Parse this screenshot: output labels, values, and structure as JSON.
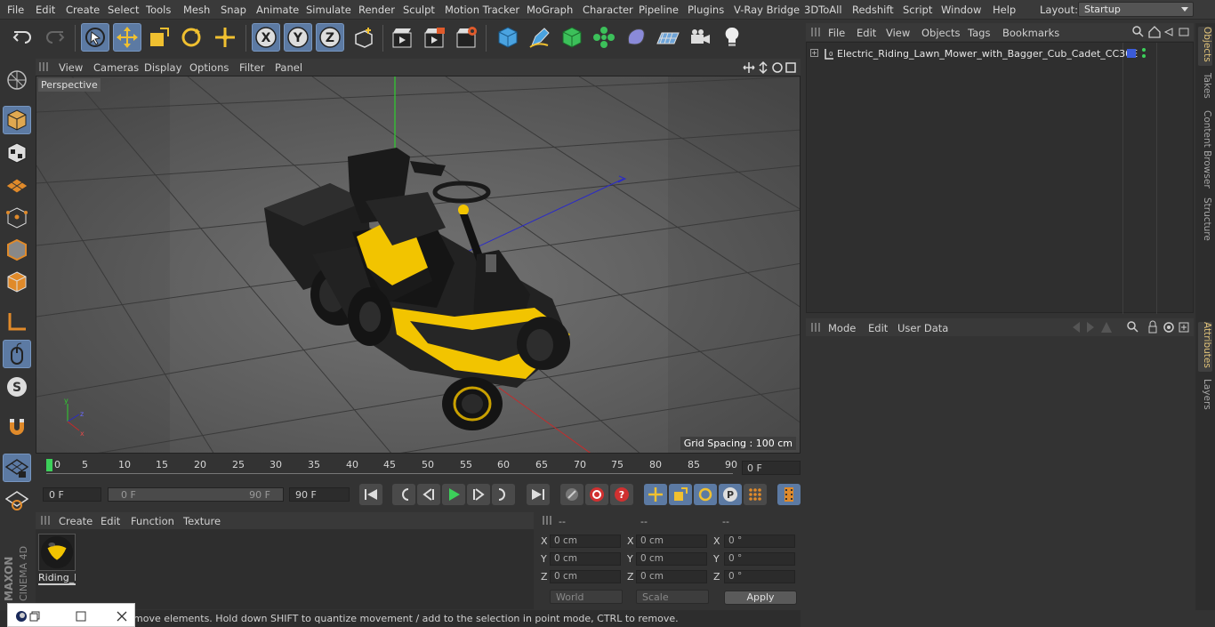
{
  "menubar": {
    "items": [
      "File",
      "Edit",
      "Create",
      "Select",
      "Tools",
      "Mesh",
      "Snap",
      "Animate",
      "Simulate",
      "Render",
      "Sculpt",
      "Motion Tracker",
      "MoGraph",
      "Character",
      "Pipeline",
      "Plugins",
      "V-Ray Bridge",
      "3DToAll",
      "Redshift",
      "Script",
      "Window",
      "Help"
    ],
    "layout_label": "Layout:",
    "layout_value": "Startup"
  },
  "toolbar": {
    "icons": [
      "undo-icon",
      "redo-icon",
      "live-select-icon",
      "move-icon",
      "scale-icon",
      "rotate-icon",
      "transform-icon",
      "x-axis-icon",
      "y-axis-icon",
      "z-axis-icon",
      "coordinate-system-icon",
      "render-view-icon",
      "render-picture-viewer-icon",
      "render-settings-icon",
      "cube-icon",
      "pen-icon",
      "subdivision-icon",
      "mograph-cloner-icon",
      "deformer-icon",
      "floor-icon",
      "camera-icon",
      "light-icon"
    ]
  },
  "viewport": {
    "menu": [
      "View",
      "Cameras",
      "Display",
      "Options",
      "Filter",
      "Panel"
    ],
    "label": "Perspective",
    "grid_spacing": "Grid Spacing : 100 cm"
  },
  "timeline": {
    "ticks": [
      "0",
      "5",
      "10",
      "15",
      "20",
      "25",
      "30",
      "35",
      "40",
      "45",
      "50",
      "55",
      "60",
      "65",
      "70",
      "75",
      "80",
      "85",
      "90"
    ],
    "current_frame": "0 F"
  },
  "transport": {
    "start": "0 F",
    "range_start": "0 F",
    "range_end": "90 F",
    "end": "90 F"
  },
  "materials": {
    "menu": [
      "Create",
      "Edit",
      "Function",
      "Texture"
    ],
    "item_name": "Riding_l"
  },
  "coordinates": {
    "headers": [
      "--",
      "--",
      "--"
    ],
    "rows": [
      {
        "axis": "X",
        "pos": "0 cm",
        "size_axis": "X",
        "size": "0 cm",
        "rot_axis": "X",
        "rot": "0 °"
      },
      {
        "axis": "Y",
        "pos": "0 cm",
        "size_axis": "Y",
        "size": "0 cm",
        "rot_axis": "Y",
        "rot": "0 °"
      },
      {
        "axis": "Z",
        "pos": "0 cm",
        "size_axis": "Z",
        "size": "0 cm",
        "rot_axis": "Z",
        "rot": "0 °"
      }
    ],
    "mode": "World",
    "scale": "Scale",
    "apply": "Apply"
  },
  "status": {
    "text": "move elements. Hold down SHIFT to quantize movement / add to the selection in point mode, CTRL to remove."
  },
  "objects": {
    "menu": [
      "File",
      "Edit",
      "View",
      "Objects",
      "Tags",
      "Bookmarks"
    ],
    "item": "Electric_Riding_Lawn_Mower_with_Bagger_Cub_Cadet_CC30E"
  },
  "attributes": {
    "menu": [
      "Mode",
      "Edit",
      "User Data"
    ]
  },
  "right_tabs": [
    "Objects",
    "Takes",
    "Content Browser",
    "Structure",
    "Attributes",
    "Layers"
  ],
  "brand": {
    "line1": "MAXON",
    "line2": "CINEMA 4D"
  },
  "colors": {
    "accent": "#5c7aa3",
    "mower_yellow": "#f2c400",
    "background": "#333333"
  }
}
